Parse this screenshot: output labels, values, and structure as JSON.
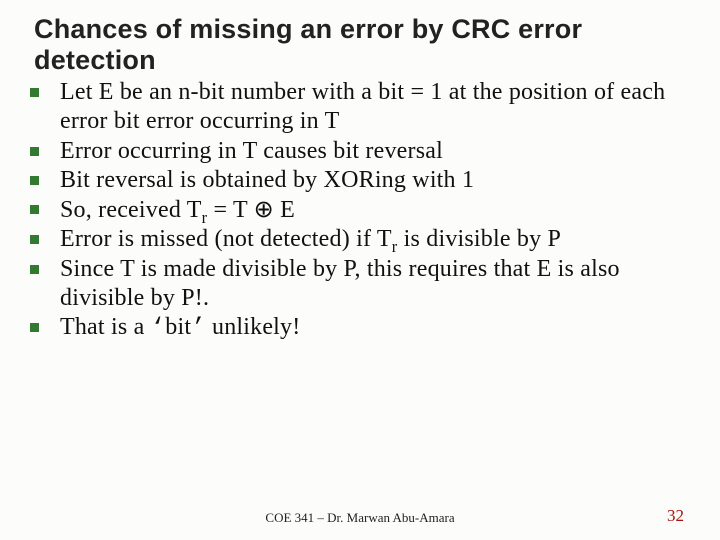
{
  "title": "Chances of missing an error by CRC error detection",
  "bullets": [
    {
      "html": "Let E be an n-bit number with a bit = 1 at the position of each error bit error occurring in T"
    },
    {
      "html": "Error occurring in T causes bit reversal"
    },
    {
      "html": "Bit reversal is obtained by XORing with 1"
    },
    {
      "html": "So, received T<sub>r</sub> = T <span class='oplus'>⊕</span> E"
    },
    {
      "html": "Error is missed (not detected) if T<sub>r</sub> is divisible by P"
    },
    {
      "html": "Since T is made divisible by P, this requires that E is also divisible by P!."
    },
    {
      "html": "That is a <span class='quote'>‘</span>bit<span class='quote'>’</span> unlikely!"
    }
  ],
  "footer": {
    "center": "COE 341 – Dr. Marwan Abu-Amara",
    "page": "32"
  }
}
